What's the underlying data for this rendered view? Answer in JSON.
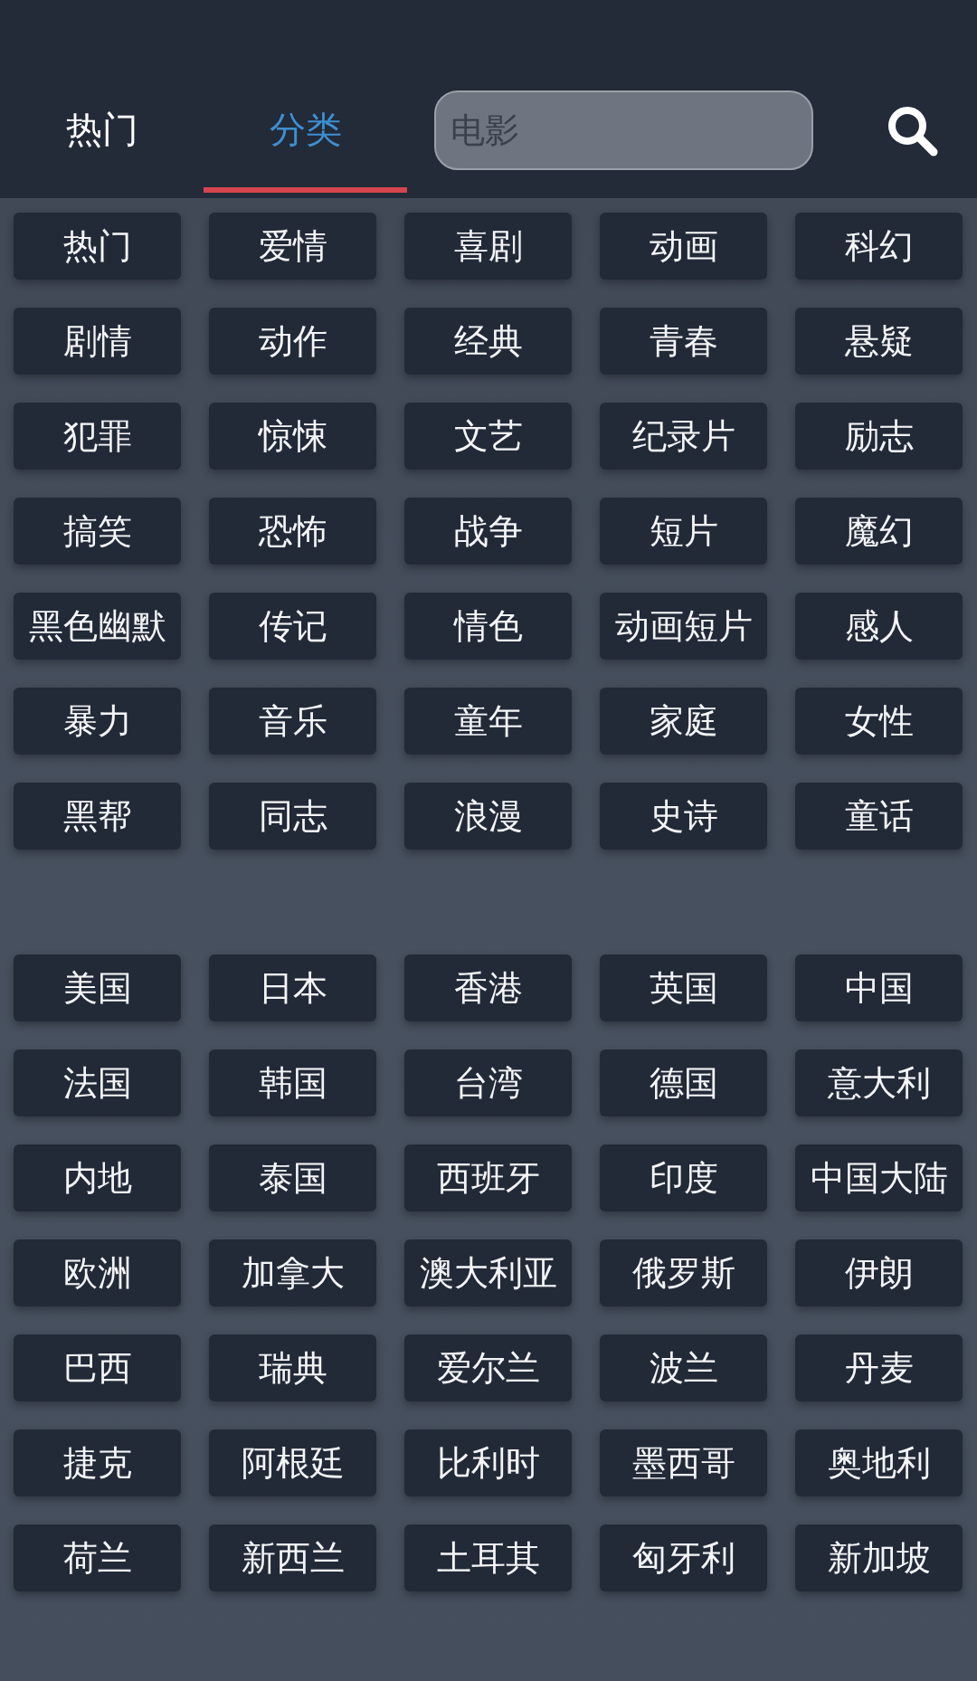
{
  "tabs": [
    {
      "label": "热门",
      "selected": false
    },
    {
      "label": "分类",
      "selected": true
    }
  ],
  "search": {
    "placeholder": "电影"
  },
  "tag_groups": [
    {
      "tags": [
        "热门",
        "爱情",
        "喜剧",
        "动画",
        "科幻",
        "剧情",
        "动作",
        "经典",
        "青春",
        "悬疑",
        "犯罪",
        "惊悚",
        "文艺",
        "纪录片",
        "励志",
        "搞笑",
        "恐怖",
        "战争",
        "短片",
        "魔幻",
        "黑色幽默",
        "传记",
        "情色",
        "动画短片",
        "感人",
        "暴力",
        "音乐",
        "童年",
        "家庭",
        "女性",
        "黑帮",
        "同志",
        "浪漫",
        "史诗",
        "童话"
      ]
    },
    {
      "tags": [
        "美国",
        "日本",
        "香港",
        "英国",
        "中国",
        "法国",
        "韩国",
        "台湾",
        "德国",
        "意大利",
        "内地",
        "泰国",
        "西班牙",
        "印度",
        "中国大陆",
        "欧洲",
        "加拿大",
        "澳大利亚",
        "俄罗斯",
        "伊朗",
        "巴西",
        "瑞典",
        "爱尔兰",
        "波兰",
        "丹麦",
        "捷克",
        "阿根廷",
        "比利时",
        "墨西哥",
        "奥地利",
        "荷兰",
        "新西兰",
        "土耳其",
        "匈牙利",
        "新加坡"
      ]
    }
  ]
}
